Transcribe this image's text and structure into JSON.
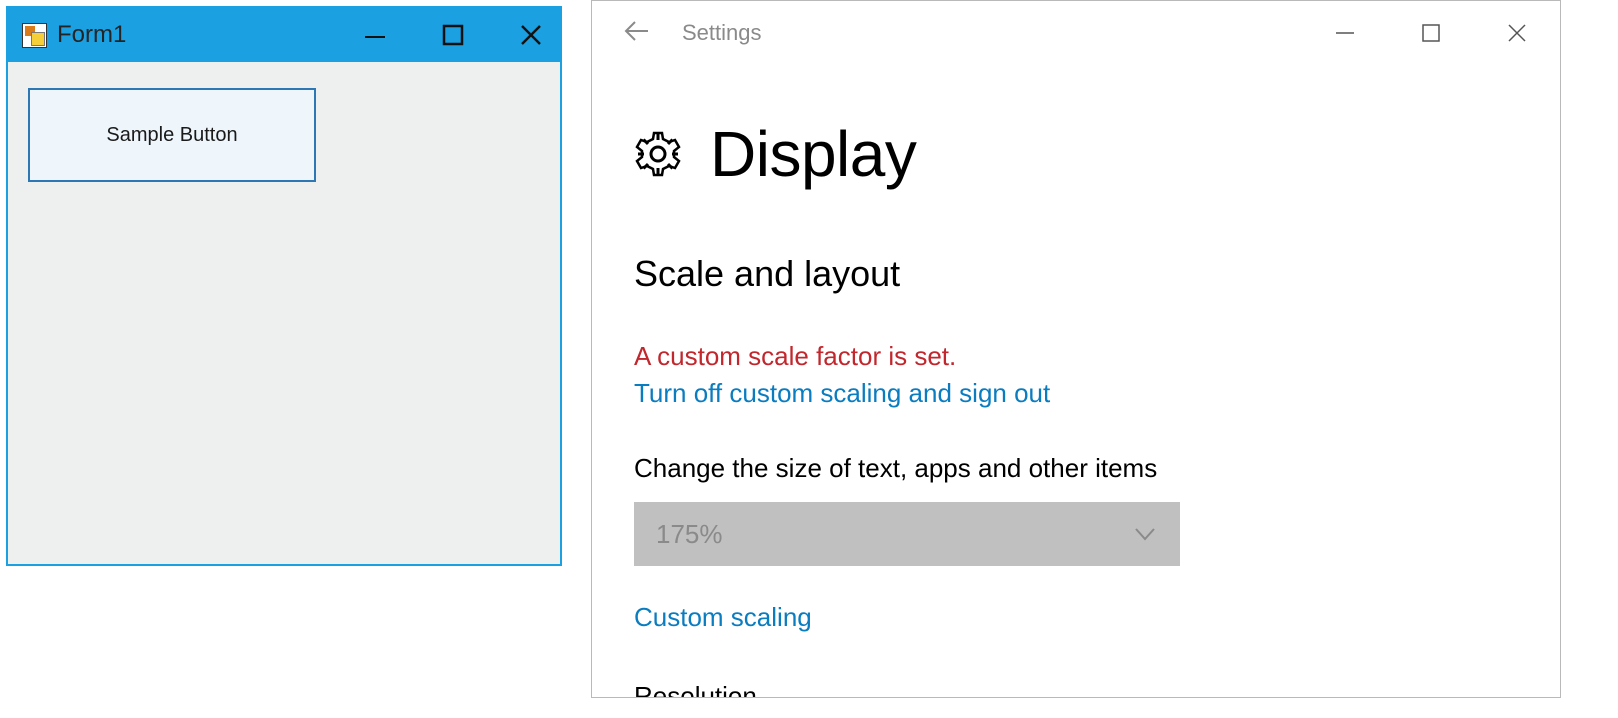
{
  "form": {
    "title": "Form1",
    "buttonLabel": "Sample Button"
  },
  "settings": {
    "windowTitle": "Settings",
    "pageTitle": "Display",
    "section1Title": "Scale and layout",
    "warningText": "A custom scale factor is set.",
    "turnOffLink": "Turn off custom scaling and sign out",
    "changeSizeLabel": "Change the size of text, apps and other items",
    "scaleValue": "175%",
    "customScalingLink": "Custom scaling",
    "resolutionHeading": "Resolution"
  }
}
